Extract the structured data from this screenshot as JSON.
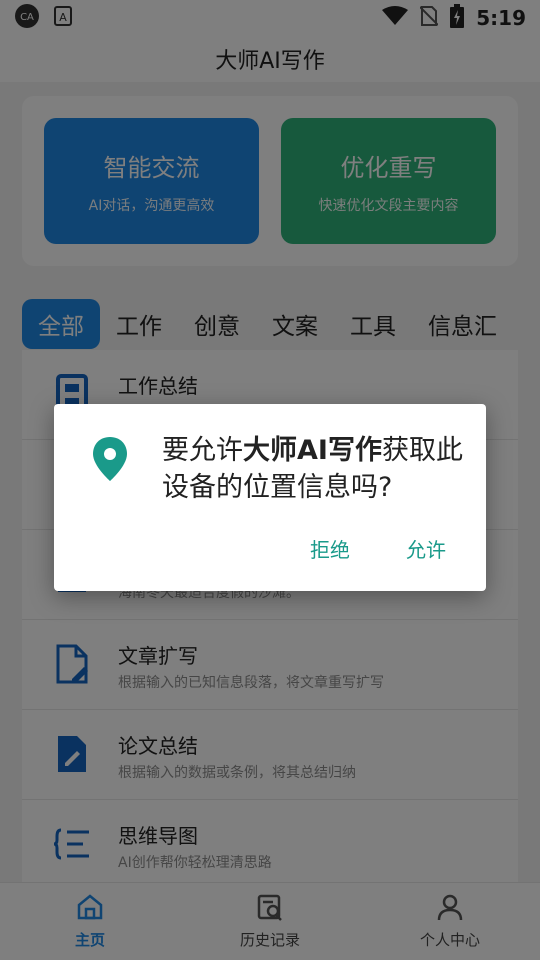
{
  "status_bar": {
    "time": "5:19",
    "icons": [
      "cast-icon",
      "a-icon",
      "wifi-icon",
      "no-sim-icon",
      "battery-icon"
    ]
  },
  "header": {
    "title": "大师AI写作"
  },
  "feature_cards": [
    {
      "title": "智能交流",
      "subtitle": "AI对话，沟通更高效",
      "color": "#1e88e5"
    },
    {
      "title": "优化重写",
      "subtitle": "快速优化文段主要内容",
      "color": "#2fb37a"
    }
  ],
  "tabs": [
    "全部",
    "工作",
    "创意",
    "文案",
    "工具",
    "信息汇"
  ],
  "active_tab": "全部",
  "list_items": [
    {
      "title": "工作总结",
      "description": "",
      "icon": "report-icon"
    },
    {
      "title": "",
      "description": "",
      "icon": ""
    },
    {
      "title": "",
      "description": "海南冬天最适合度假的沙滩。",
      "icon": ""
    },
    {
      "title": "文章扩写",
      "description": "根据输入的已知信息段落，将文章重写扩写",
      "icon": "document-edit-icon"
    },
    {
      "title": "论文总结",
      "description": "根据输入的数据或条例，将其总结归纳",
      "icon": "paper-edit-icon"
    },
    {
      "title": "思维导图",
      "description": "AI创作帮你轻松理清思路",
      "icon": "mindmap-icon"
    }
  ],
  "bottom_nav": [
    {
      "label": "主页",
      "icon": "home-icon",
      "active": true
    },
    {
      "label": "历史记录",
      "icon": "history-icon",
      "active": false
    },
    {
      "label": "个人中心",
      "icon": "person-icon",
      "active": false
    }
  ],
  "dialog": {
    "message_prefix": "要允许",
    "app_name": "大师AI写作",
    "message_suffix": "获取此设备的位置信息吗?",
    "deny_label": "拒绝",
    "allow_label": "允许",
    "icon": "location-pin-icon",
    "accent_color": "#1a9a8a"
  }
}
